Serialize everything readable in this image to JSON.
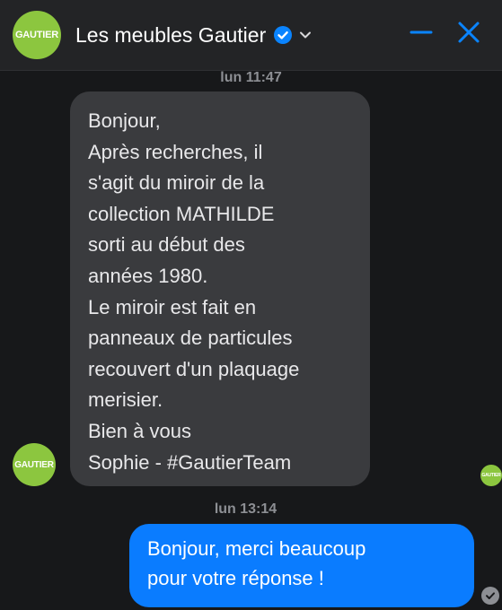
{
  "header": {
    "avatar_text": "GAUTIER",
    "title": "Les meubles Gautier",
    "accent_color": "#0a84ff",
    "icons": [
      "verified-badge-icon",
      "chevron-down-icon",
      "minimize-icon",
      "close-icon"
    ]
  },
  "conversation": {
    "timestamp_1": "lun 11:47",
    "incoming": {
      "sender_avatar_text": "GAUTIER",
      "lines": [
        "Bonjour,",
        "Après recherches, il",
        "s'agit du miroir de la",
        "collection MATHILDE",
        "sorti au début des",
        "années 1980.",
        "Le miroir est fait en",
        "panneaux de particules",
        "recouvert d'un plaquage",
        "merisier.",
        "Bien à vous",
        "Sophie - #GautierTeam"
      ]
    },
    "timestamp_2": "lun 13:14",
    "outgoing": {
      "lines": [
        "Bonjour, merci beaucoup",
        "pour votre réponse !"
      ]
    },
    "seen_avatar_text": "GAUTIER"
  }
}
